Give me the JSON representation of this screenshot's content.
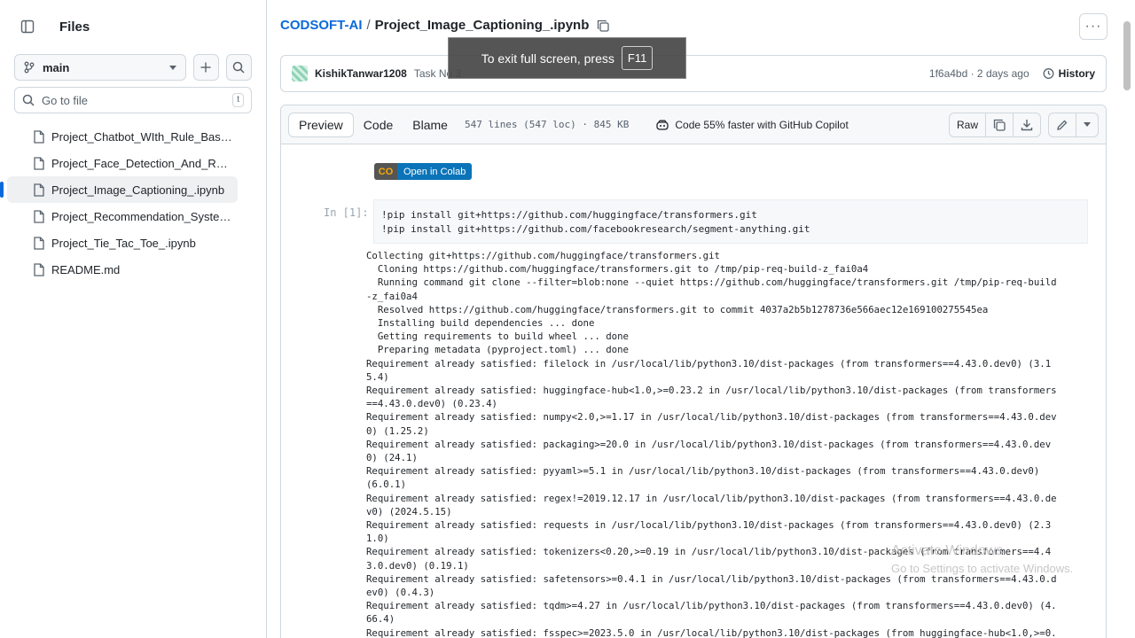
{
  "sidebar": {
    "title": "Files",
    "branch": "main",
    "goto_placeholder": "Go to file",
    "goto_shortcut": "t",
    "files": [
      {
        "label": "Project_Chatbot_WIth_Rule_Based_Responses.ipynb"
      },
      {
        "label": "Project_Face_Detection_And_Recognition.ipynb"
      },
      {
        "label": "Project_Image_Captioning_.ipynb"
      },
      {
        "label": "Project_Recommendation_System.ipynb"
      },
      {
        "label": "Project_Tie_Tac_Toe_.ipynb"
      },
      {
        "label": "README.md"
      }
    ],
    "active_index": 2
  },
  "breadcrumb": {
    "repo": "CODSOFT-AI",
    "separator": "/",
    "file": "Project_Image_Captioning_.ipynb"
  },
  "commit": {
    "author": "KishikTanwar1208",
    "message": "Task No 3",
    "meta": "1f6a4bd · 2 days ago",
    "history_label": "History"
  },
  "fullscreen_toast": {
    "text": "To exit full screen, press",
    "key": "F11"
  },
  "toolbar": {
    "tabs": [
      "Preview",
      "Code",
      "Blame"
    ],
    "active_tab": "Preview",
    "stats": "547 lines (547 loc) · 845 KB",
    "copilot": "Code 55% faster with GitHub Copilot",
    "raw_label": "Raw"
  },
  "notebook": {
    "colab_badge": "Open in Colab",
    "colab_logo": "CO",
    "prompt": "In [1]:",
    "code": "!pip install git+https://github.com/huggingface/transformers.git\n!pip install git+https://github.com/facebookresearch/segment-anything.git",
    "output": "Collecting git+https://github.com/huggingface/transformers.git\n  Cloning https://github.com/huggingface/transformers.git to /tmp/pip-req-build-z_fai0a4\n  Running command git clone --filter=blob:none --quiet https://github.com/huggingface/transformers.git /tmp/pip-req-build\n-z_fai0a4\n  Resolved https://github.com/huggingface/transformers.git to commit 4037a2b5b1278736e566aec12e169100275545ea\n  Installing build dependencies ... done\n  Getting requirements to build wheel ... done\n  Preparing metadata (pyproject.toml) ... done\nRequirement already satisfied: filelock in /usr/local/lib/python3.10/dist-packages (from transformers==4.43.0.dev0) (3.1\n5.4)\nRequirement already satisfied: huggingface-hub<1.0,>=0.23.2 in /usr/local/lib/python3.10/dist-packages (from transformers\n==4.43.0.dev0) (0.23.4)\nRequirement already satisfied: numpy<2.0,>=1.17 in /usr/local/lib/python3.10/dist-packages (from transformers==4.43.0.dev\n0) (1.25.2)\nRequirement already satisfied: packaging>=20.0 in /usr/local/lib/python3.10/dist-packages (from transformers==4.43.0.dev\n0) (24.1)\nRequirement already satisfied: pyyaml>=5.1 in /usr/local/lib/python3.10/dist-packages (from transformers==4.43.0.dev0)\n(6.0.1)\nRequirement already satisfied: regex!=2019.12.17 in /usr/local/lib/python3.10/dist-packages (from transformers==4.43.0.de\nv0) (2024.5.15)\nRequirement already satisfied: requests in /usr/local/lib/python3.10/dist-packages (from transformers==4.43.0.dev0) (2.3\n1.0)\nRequirement already satisfied: tokenizers<0.20,>=0.19 in /usr/local/lib/python3.10/dist-packages (from transformers==4.4\n3.0.dev0) (0.19.1)\nRequirement already satisfied: safetensors>=0.4.1 in /usr/local/lib/python3.10/dist-packages (from transformers==4.43.0.d\nev0) (0.4.3)\nRequirement already satisfied: tqdm>=4.27 in /usr/local/lib/python3.10/dist-packages (from transformers==4.43.0.dev0) (4.\n66.4)\nRequirement already satisfied: fsspec>=2023.5.0 in /usr/local/lib/python3.10/dist-packages (from huggingface-hub<1.0,>=0."
  },
  "watermark": {
    "title": "Activate Windows",
    "subtitle": "Go to Settings to activate Windows."
  },
  "colors": {
    "accent": "#0969da",
    "border": "#d0d7de"
  }
}
